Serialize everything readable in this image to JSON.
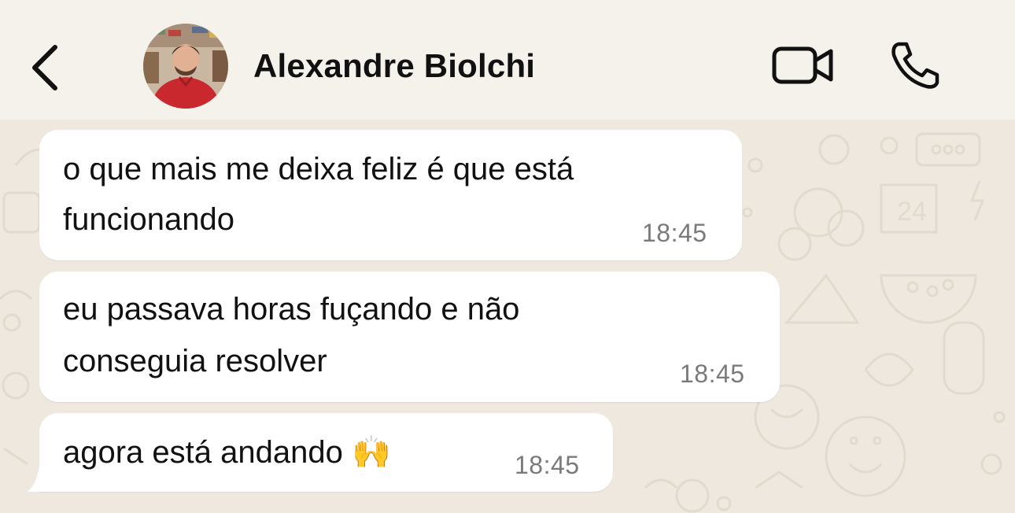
{
  "header": {
    "contact_name": "Alexandre Biolchi",
    "back_icon": "chevron-left-icon",
    "video_icon": "video-camera-icon",
    "call_icon": "phone-icon"
  },
  "messages": [
    {
      "line1": "o que mais me deixa feliz é que está",
      "line2": "funcionando",
      "time": "18:45"
    },
    {
      "line1": "eu passava horas fuçando e não",
      "line2": "conseguia resolver",
      "time": "18:45"
    },
    {
      "line1": "agora está andando 🙌",
      "time": "18:45"
    }
  ],
  "colors": {
    "background": "#efe8de",
    "header": "#f5f1eb",
    "bubble": "#ffffff",
    "timestamp": "#7a7a7a"
  }
}
